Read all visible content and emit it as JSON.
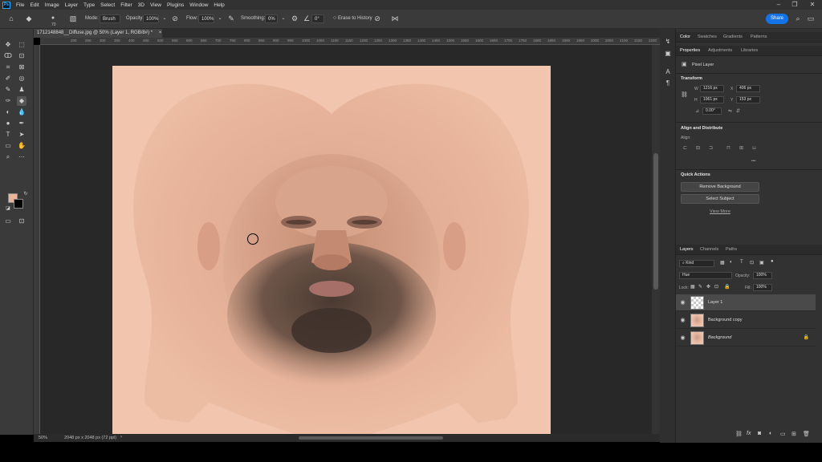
{
  "app": {
    "logo": "Ps"
  },
  "menu": [
    "File",
    "Edit",
    "Image",
    "Layer",
    "Type",
    "Select",
    "Filter",
    "3D",
    "View",
    "Plugins",
    "Window",
    "Help"
  ],
  "window_controls": {
    "minimize": "–",
    "restore": "❐",
    "close": "✕"
  },
  "options_bar": {
    "brush_size": "70",
    "mode_label": "Mode:",
    "mode_value": "Brush",
    "opacity_label": "Opacity:",
    "opacity_value": "100%",
    "flow_label": "Flow:",
    "flow_value": "100%",
    "smoothing_label": "Smoothing:",
    "smoothing_value": "0%",
    "angle_value": "0°",
    "erase_history_label": "Erase to History",
    "share_label": "Share"
  },
  "document": {
    "tab_title": "1712148848__Diffuse.jpg @ 50% (Layer 1, RGB/8#) *",
    "close": "×",
    "zoom": "50%",
    "doc_info": "2048 px x 2048 px (72 ppi)"
  },
  "ruler_ticks": [
    "200",
    "250",
    "300",
    "350",
    "400",
    "450",
    "500",
    "550",
    "600",
    "650",
    "700",
    "750",
    "800",
    "850",
    "900",
    "950",
    "1000",
    "1050",
    "1100",
    "1150",
    "1200",
    "1250",
    "1300",
    "1350",
    "1400",
    "1450",
    "1500",
    "1550",
    "1600",
    "1650",
    "1700",
    "1750",
    "1800",
    "1850",
    "1900",
    "1950",
    "2000",
    "2050",
    "2100",
    "2150",
    "2200"
  ],
  "colors": {
    "foreground": "#e8b59b",
    "background": "#000000",
    "accent": "#1473e6"
  },
  "panel_tabs_top": [
    "Color",
    "Swatches",
    "Gradients",
    "Patterns"
  ],
  "panel_tabs_props": [
    "Properties",
    "Adjustments",
    "Libraries"
  ],
  "properties": {
    "layer_kind": "Pixel Layer",
    "transform_title": "Transform",
    "w_label": "W",
    "w_value": "1216 px",
    "h_label": "H",
    "h_value": "1061 px",
    "x_label": "X",
    "x_value": "406 px",
    "y_label": "Y",
    "y_value": "153 px",
    "angle_value": "0.00°",
    "align_title": "Align and Distribute",
    "align_label": "Align:",
    "more": "•••",
    "quick_actions_title": "Quick Actions",
    "remove_bg": "Remove Background",
    "select_subject": "Select Subject",
    "view_more": "View More"
  },
  "layers_panel": {
    "tabs": [
      "Layers",
      "Channels",
      "Paths"
    ],
    "kind_label": "Kind",
    "blend_mode": "Hue",
    "opacity_label": "Opacity:",
    "opacity_value": "100%",
    "lock_label": "Lock:",
    "fill_label": "Fill:",
    "fill_value": "100%",
    "layers": [
      {
        "name": "Layer 1",
        "selected": true,
        "thumb": "transparent"
      },
      {
        "name": "Background copy",
        "selected": false,
        "thumb": "face"
      },
      {
        "name": "Background",
        "selected": false,
        "thumb": "face",
        "locked": true
      }
    ]
  }
}
